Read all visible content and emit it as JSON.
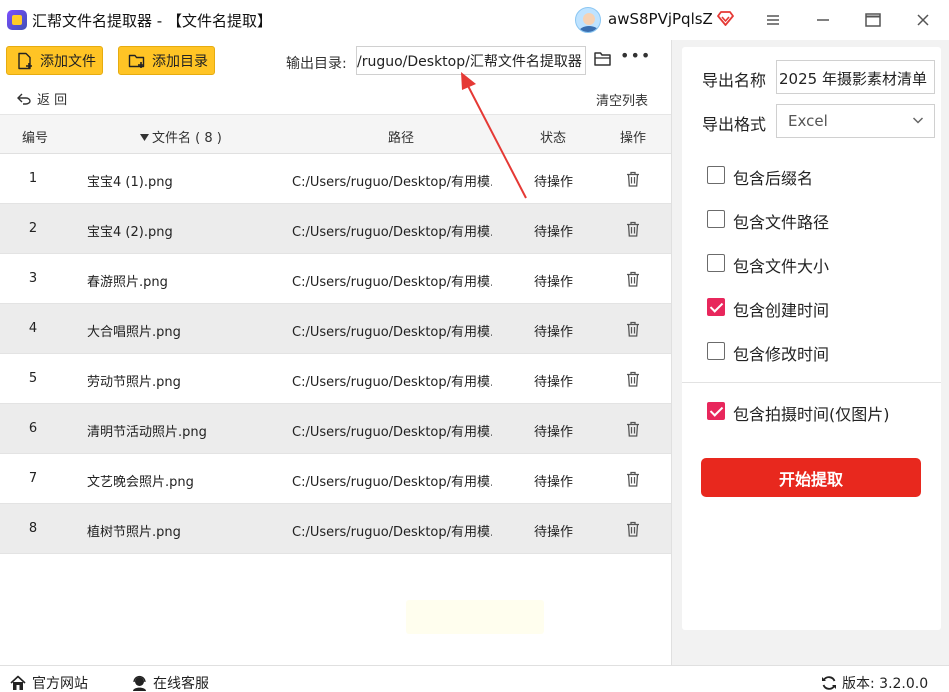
{
  "window": {
    "title": "汇帮文件名提取器 - 【文件名提取】",
    "username": "awS8PVjPqlsZ",
    "icons": [
      "app-logo-icon",
      "avatar-icon",
      "vip-diamond-icon",
      "menu-icon",
      "minimize-icon",
      "maximize-icon",
      "close-icon"
    ]
  },
  "toolbar": {
    "add_file": "添加文件",
    "add_dir": "添加目录",
    "output_label": "输出目录:",
    "output_path": "/ruguo/Desktop/汇帮文件名提取器",
    "back": "返 回",
    "clear": "清空列表"
  },
  "table": {
    "headers": {
      "num": "编号",
      "name": "文件名 ( 8 )",
      "path": "路径",
      "status": "状态",
      "action": "操作"
    },
    "rows": [
      {
        "num": "1",
        "name": "宝宝4 (1).png",
        "path": "C:/Users/ruguo/Desktop/有用模...",
        "status": "待操作"
      },
      {
        "num": "2",
        "name": "宝宝4 (2).png",
        "path": "C:/Users/ruguo/Desktop/有用模...",
        "status": "待操作"
      },
      {
        "num": "3",
        "name": "春游照片.png",
        "path": "C:/Users/ruguo/Desktop/有用模...",
        "status": "待操作"
      },
      {
        "num": "4",
        "name": "大合唱照片.png",
        "path": "C:/Users/ruguo/Desktop/有用模...",
        "status": "待操作"
      },
      {
        "num": "5",
        "name": "劳动节照片.png",
        "path": "C:/Users/ruguo/Desktop/有用模...",
        "status": "待操作"
      },
      {
        "num": "6",
        "name": "清明节活动照片.png",
        "path": "C:/Users/ruguo/Desktop/有用模...",
        "status": "待操作"
      },
      {
        "num": "7",
        "name": "文艺晚会照片.png",
        "path": "C:/Users/ruguo/Desktop/有用模...",
        "status": "待操作"
      },
      {
        "num": "8",
        "name": "植树节照片.png",
        "path": "C:/Users/ruguo/Desktop/有用模...",
        "status": "待操作"
      }
    ]
  },
  "settings": {
    "export_name_label": "导出名称",
    "export_name_value": "2025 年摄影素材清单",
    "export_format_label": "导出格式",
    "export_format_value": "Excel",
    "options": [
      {
        "label": "包含后缀名",
        "checked": false
      },
      {
        "label": "包含文件路径",
        "checked": false
      },
      {
        "label": "包含文件大小",
        "checked": false
      },
      {
        "label": "包含创建时间",
        "checked": true
      },
      {
        "label": "包含修改时间",
        "checked": false
      }
    ],
    "extra_option": {
      "label": "包含拍摄时间(仅图片)",
      "checked": true
    },
    "start_button": "开始提取"
  },
  "statusbar": {
    "website": "官方网站",
    "support": "在线客服",
    "version": "版本:  3.2.0.0"
  },
  "colors": {
    "accent_yellow": "#ffc425",
    "start_red": "#e8281e",
    "checkbox_pink": "#e8275c",
    "annotation_arrow": "#e53935"
  }
}
